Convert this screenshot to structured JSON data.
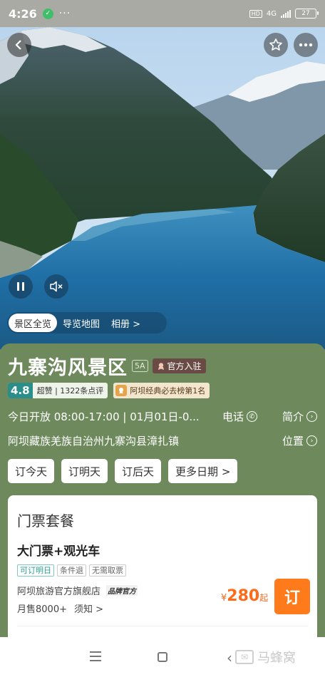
{
  "status_bar": {
    "time": "4:26",
    "dots": "···",
    "hd": "HD",
    "network": "4G",
    "battery": "27"
  },
  "hero": {
    "tabs": [
      {
        "label": "景区全览",
        "active": true
      },
      {
        "label": "导览地图",
        "active": false
      },
      {
        "label": "相册 >",
        "active": false
      }
    ]
  },
  "attraction": {
    "name": "九寨沟风景区",
    "level": "5A",
    "official_badge": "官方入驻",
    "rating": "4.8",
    "rating_text": "超赞 | 1322条点评",
    "rank_text": "阿坝经典必去榜第1名",
    "hours": "今日开放 08:00-17:00 | 01月01日-0...",
    "phone_label": "电话",
    "intro_label": "简介",
    "address": "阿坝藏族羌族自治州九寨沟县漳扎镇",
    "location_label": "位置"
  },
  "date_buttons": [
    "订今天",
    "订明天",
    "订后天",
    "更多日期 >"
  ],
  "ticket": {
    "section_title": "门票套餐",
    "name": "大门票+观光车",
    "tags": [
      "可订明日",
      "条件退",
      "无需取票"
    ],
    "shop": "阿坝旅游官方旗舰店",
    "shop_badge": "品牌官方",
    "monthly_sales": "月售8000+",
    "notice": "须知 >",
    "price_symbol": "¥",
    "price": "280",
    "price_suffix": "起",
    "book_label": "订"
  },
  "watermark": {
    "text": "马蜂窝"
  }
}
